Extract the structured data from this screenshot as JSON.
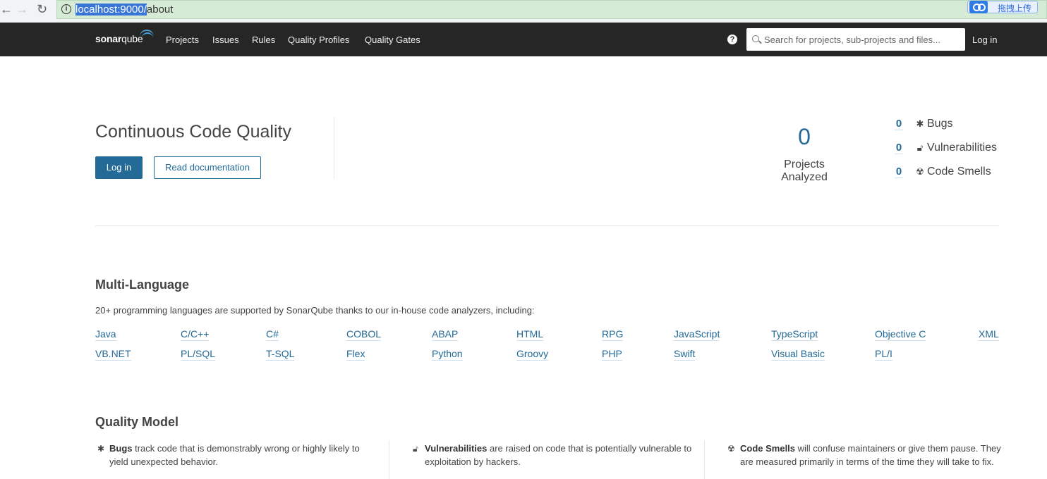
{
  "browser": {
    "back_icon": "←",
    "forward_icon": "→",
    "reload_icon": "↻",
    "url_host": "localhost:9000/",
    "url_path": "about",
    "upload_label": "拖拽上传"
  },
  "navbar": {
    "logo_bold": "sonar",
    "logo_light": "qube",
    "links": [
      "Projects",
      "Issues",
      "Rules",
      "Quality Profiles",
      "Quality Gates"
    ],
    "search_placeholder": "Search for projects, sub-projects and files...",
    "login": "Log in"
  },
  "hero": {
    "title": "Continuous Code Quality",
    "login_button": "Log in",
    "docs_button": "Read documentation",
    "projects_count": "0",
    "projects_label": "Projects Analyzed",
    "stats": [
      {
        "count": "0",
        "label": "Bugs",
        "icon": "bug-icon"
      },
      {
        "count": "0",
        "label": "Vulnerabilities",
        "icon": "lock-icon"
      },
      {
        "count": "0",
        "label": "Code Smells",
        "icon": "radiation-icon"
      }
    ]
  },
  "multi_language": {
    "title": "Multi-Language",
    "text": "20+ programming languages are supported by SonarQube thanks to our in-house code analyzers, including:",
    "row1": [
      "Java",
      "C/C++",
      "C#",
      "COBOL",
      "ABAP",
      "HTML",
      "RPG",
      "JavaScript",
      "TypeScript",
      "Objective C",
      "XML"
    ],
    "row2": [
      "VB.NET",
      "PL/SQL",
      "T-SQL",
      "Flex",
      "Python",
      "Groovy",
      "PHP",
      "Swift",
      "Visual Basic",
      "PL/I"
    ]
  },
  "quality_model": {
    "title": "Quality Model",
    "bugs_term": "Bugs",
    "bugs_text": " track code that is demonstrably wrong or highly likely to yield unexpected behavior.",
    "vuln_term": "Vulnerabilities",
    "vuln_text": " are raised on code that is potentially vulnerable to exploitation by hackers.",
    "smells_term": "Code Smells",
    "smells_text": " will confuse maintainers or give them pause. They are measured primarily in terms of the time they will take to fix."
  },
  "colors": {
    "navbar": "#262626",
    "accent": "#236a97",
    "address_bar": "#d5ebd5"
  }
}
